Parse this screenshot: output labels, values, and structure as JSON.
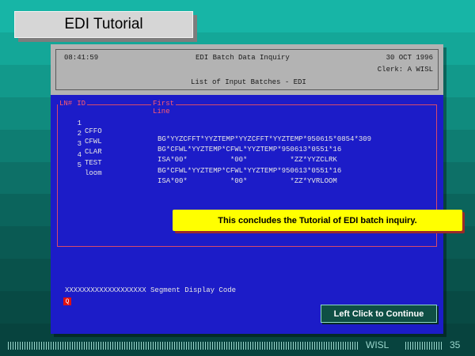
{
  "slide": {
    "title": "EDI Tutorial",
    "brand": "WISL",
    "page_number": "35",
    "continue_label": "Left Click to Continue",
    "callout_text": "This concludes the Tutorial of EDI batch inquiry."
  },
  "screen": {
    "time": "08:41:59",
    "title": "EDI Batch Data Inquiry",
    "date": "30 OCT 1996",
    "clerk": "Clerk: A WISL",
    "subtitle": "List of Input Batches - EDI"
  },
  "list": {
    "col_num": "LN#",
    "col_id": "ID",
    "col_line": "First Line",
    "rows": [
      {
        "num": "1",
        "id": "CFFO",
        "line": "BG*YYZCFFT*YYZTEMP*YYZCFFT*YYZTEMP*950615*0854*309"
      },
      {
        "num": "2",
        "id": "CFWL",
        "line": "BG*CFWL*YYZTEMP*CFWL*YYZTEMP*950613*0551*16"
      },
      {
        "num": "3",
        "id": "CLAR",
        "line": "ISA*00*          *00*          *ZZ*YYZCLRK"
      },
      {
        "num": "4",
        "id": "TEST",
        "line": "BG*CFWL*YYZTEMP*CFWL*YYZTEMP*950613*0551*16"
      },
      {
        "num": "5",
        "id": "loom",
        "line": "ISA*00*          *00*          *ZZ*YVRLOOM"
      }
    ]
  },
  "legend": {
    "text": "XXXXXXXXXXXXXXXXXXX Segment Display Code",
    "q_key": "Q"
  },
  "colors": {
    "screen_bg": "#1c1cc8",
    "callout_bg": "#ffff00",
    "header_bg": "#b3b3b3",
    "accent_red": "#ff5a6e"
  }
}
